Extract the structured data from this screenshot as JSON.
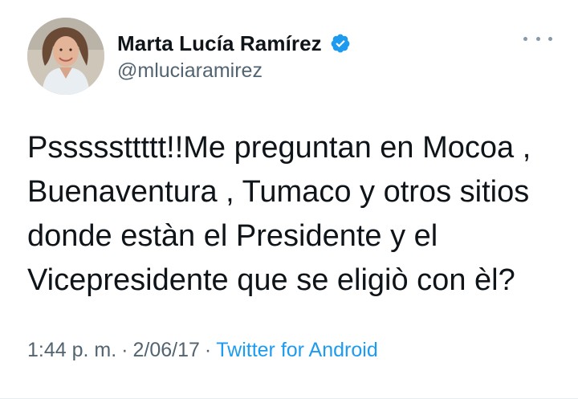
{
  "author": {
    "display_name": "Marta Lucía Ramírez",
    "handle": "@mluciaramirez",
    "verified": true,
    "avatar_icon": "profile-photo"
  },
  "more_icon": "more-dots-icon",
  "tweet": {
    "text_lines": [
      "Psssssttttt!!Me preguntan en Mocoa ,",
      "Buenaventura , Tumaco y otros sitios",
      "donde estàn el Presidente y el",
      "Vicepresidente que se eligiò con èl?"
    ]
  },
  "meta": {
    "time": "1:44 p. m.",
    "separator": "·",
    "date": "2/06/17",
    "source": "Twitter for Android"
  },
  "colors": {
    "text": "#0f1419",
    "secondary": "#536471",
    "link": "#1d9bf0",
    "verified": "#1d9bf0"
  }
}
